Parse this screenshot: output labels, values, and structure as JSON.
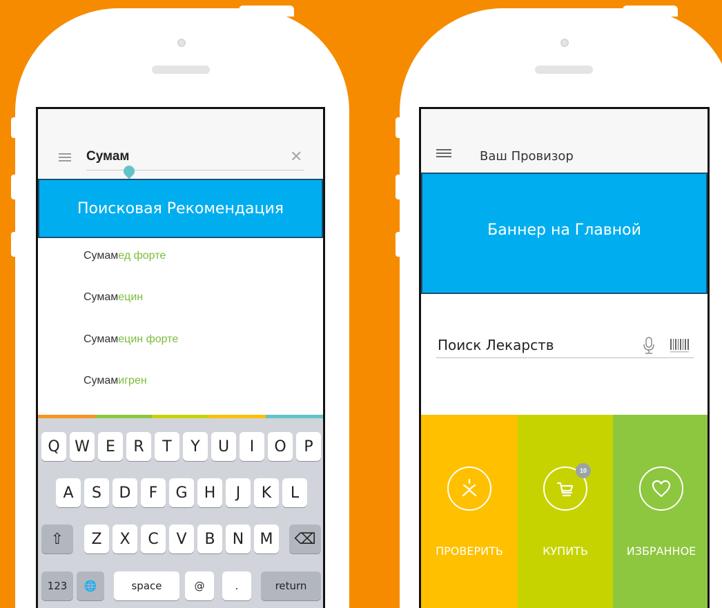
{
  "left_phone": {
    "search_value": "Сумам",
    "banner_label": "Поисковая Рекомендация",
    "suggestions": [
      {
        "prefix": "Сумам",
        "rest": "ед форте"
      },
      {
        "prefix": "Сумам",
        "rest": "ецин"
      },
      {
        "prefix": "Сумам",
        "rest": "ецин форте"
      },
      {
        "prefix": "Сумам",
        "rest": "игрен"
      }
    ],
    "strip_colors": [
      "#f7941d",
      "#8dc63f",
      "#c6d300",
      "#ffc000",
      "#62c3c8"
    ],
    "keyboard": {
      "row1": [
        "Q",
        "W",
        "E",
        "R",
        "T",
        "Y",
        "U",
        "I",
        "O",
        "P"
      ],
      "row2": [
        "A",
        "S",
        "D",
        "F",
        "G",
        "H",
        "J",
        "K",
        "L"
      ],
      "row3": [
        "Z",
        "X",
        "C",
        "V",
        "B",
        "N",
        "M"
      ],
      "shift": "⇧",
      "backspace": "⌫",
      "numbers": "123",
      "globe": "🌐",
      "space": "space",
      "at": "@",
      "dot": ".",
      "return": "return"
    },
    "icons": {
      "menu": "menu-icon",
      "close": "close-icon",
      "close_glyph": "✕"
    }
  },
  "right_phone": {
    "title": "Ваш Провизор",
    "banner_label": "Баннер на Главной",
    "search_label": "Поиск Лекарств",
    "tiles": [
      {
        "label": "ПРОВЕРИТЬ",
        "icon": "check-icon",
        "color": "#ffc000"
      },
      {
        "label": "КУПИТЬ",
        "icon": "cart-icon",
        "color": "#c6d300",
        "badge": "10"
      },
      {
        "label": "ИЗБРАННОЕ",
        "icon": "heart-icon",
        "color": "#8dc63f"
      }
    ]
  },
  "colors": {
    "background": "#f68b00",
    "banner": "#00aeef",
    "suggestion_highlight": "#7cbd3a"
  }
}
